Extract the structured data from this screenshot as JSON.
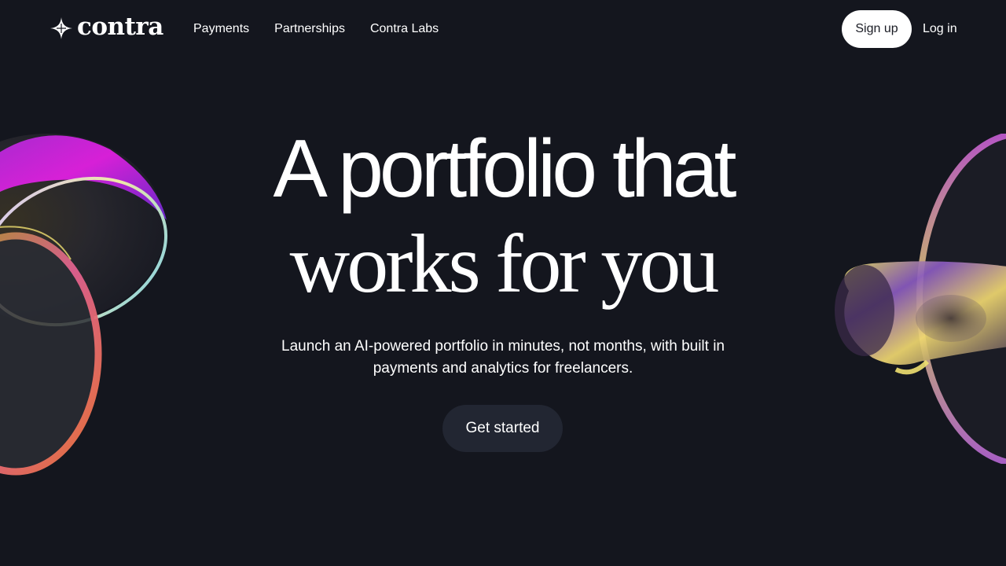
{
  "brand": {
    "name": "contra",
    "logo_icon": "four-point-star-icon"
  },
  "nav": {
    "links": [
      {
        "label": "Payments"
      },
      {
        "label": "Partnerships"
      },
      {
        "label": "Contra Labs"
      }
    ],
    "signup_label": "Sign up",
    "login_label": "Log in"
  },
  "hero": {
    "headline_line1": "A portfolio that",
    "headline_line2": "works for you",
    "subheading": "Launch an AI-powered portfolio in minutes, not months, with built in payments and analytics for freelancers.",
    "cta_label": "Get started"
  },
  "colors": {
    "background": "#14161e",
    "text": "#ffffff",
    "signup_bg": "#ffffff",
    "cta_bg": "#222632"
  }
}
